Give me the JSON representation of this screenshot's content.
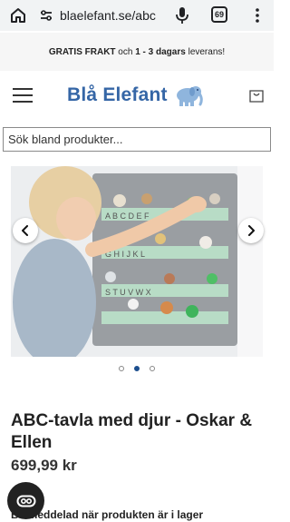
{
  "browser": {
    "url": "blaelefant.se/abc",
    "tab_count": "69",
    "icons": [
      "home-icon",
      "site-settings-icon",
      "mic-icon",
      "tabs-icon",
      "more-menu-icon"
    ]
  },
  "announcement": {
    "part1": "GRATIS FRAKT",
    "part2": " och ",
    "part3": "1 - 3 dagars",
    "part4": " leverans!"
  },
  "header": {
    "logo_text": "Blå Elefant",
    "icons": [
      "hamburger-menu-icon",
      "elephant-logo-icon",
      "cart-icon"
    ]
  },
  "search": {
    "placeholder": "Sök bland produkter..."
  },
  "carousel": {
    "slide_count": 3,
    "active_index": 1,
    "icons": [
      "chevron-left-icon",
      "chevron-right-icon"
    ]
  },
  "product": {
    "title": "ABC-tavla med djur - Oskar & Ellen",
    "price": "699,99 kr",
    "delivery_note": "Bli meddelad när produkten är i lager"
  },
  "colors": {
    "brand_blue": "#3566a6",
    "active_dot": "#1d4f8e",
    "chat_button": "#222222"
  }
}
